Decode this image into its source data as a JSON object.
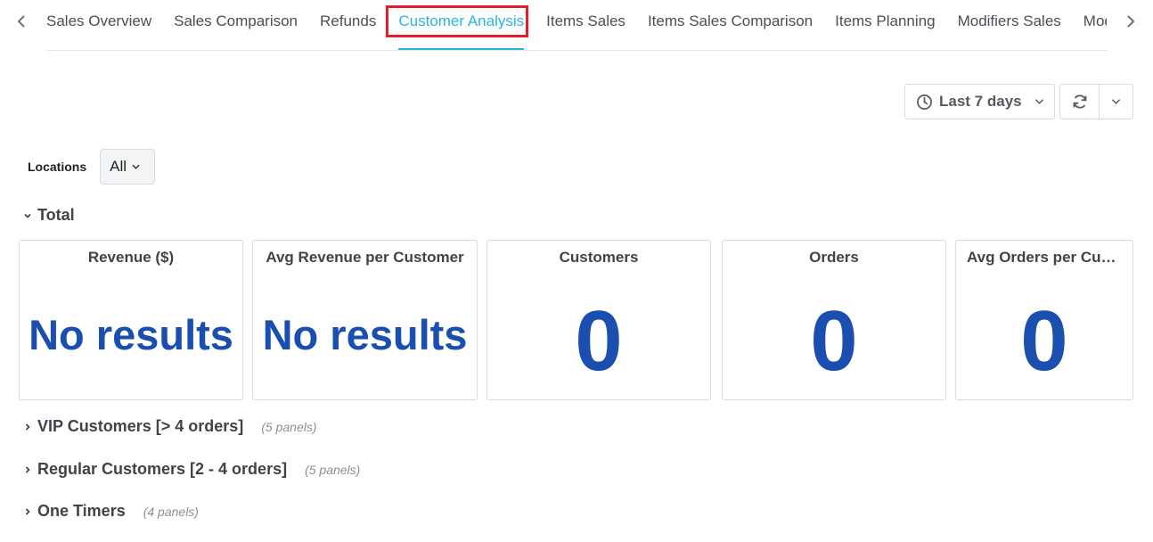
{
  "tabs": {
    "items": [
      {
        "label": "Sales Overview",
        "active": false
      },
      {
        "label": "Sales Comparison",
        "active": false
      },
      {
        "label": "Refunds",
        "active": false
      },
      {
        "label": "Customer Analysis",
        "active": true
      },
      {
        "label": "Items Sales",
        "active": false
      },
      {
        "label": "Items Sales Comparison",
        "active": false
      },
      {
        "label": "Items Planning",
        "active": false
      },
      {
        "label": "Modifiers Sales",
        "active": false
      },
      {
        "label": "Modifiers Sales Comparison",
        "active": false
      }
    ],
    "prev_icon": "chevron-left-icon",
    "next_icon": "chevron-right-icon",
    "highlight_color": "#e3202a",
    "active_color": "#2ab4e0"
  },
  "toolbar": {
    "date_range": "Last 7 days",
    "date_icon": "clock-icon",
    "refresh_icon": "refresh-icon",
    "more_icon": "chevron-down-icon"
  },
  "filters": {
    "locations_label": "Locations",
    "locations_value": "All"
  },
  "sections": [
    {
      "title": "Total",
      "expanded": true,
      "panels": [
        {
          "title": "Revenue ($)",
          "value": "No results"
        },
        {
          "title": "Avg Revenue per Customer",
          "title_display": "Avg Revenue per Custo...",
          "value": "No results"
        },
        {
          "title": "Customers",
          "value": "0"
        },
        {
          "title": "Orders",
          "value": "0"
        },
        {
          "title": "Avg Orders per Customer",
          "title_display": "Avg Orders per C...",
          "value": "0"
        }
      ]
    },
    {
      "title": "VIP Customers [> 4 orders]",
      "expanded": false,
      "count": "(5 panels)"
    },
    {
      "title": "Regular Customers [2 - 4 orders]",
      "expanded": false,
      "count": "(5 panels)"
    },
    {
      "title": "One Timers",
      "expanded": false,
      "count": "(4 panels)"
    }
  ],
  "colors": {
    "value_color": "#1a4fb0"
  }
}
